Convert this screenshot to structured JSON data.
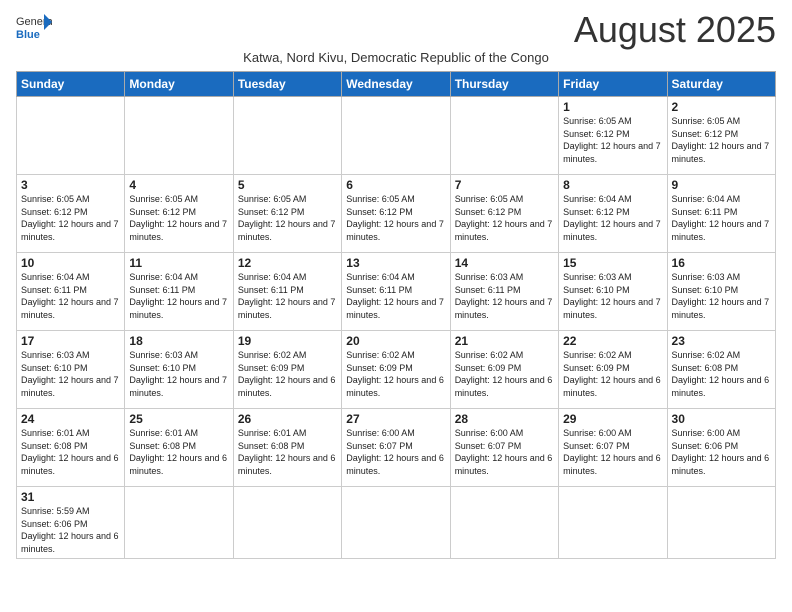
{
  "header": {
    "logo_general": "General",
    "logo_blue": "Blue",
    "month_title": "August 2025",
    "subtitle": "Katwa, Nord Kivu, Democratic Republic of the Congo"
  },
  "weekdays": [
    "Sunday",
    "Monday",
    "Tuesday",
    "Wednesday",
    "Thursday",
    "Friday",
    "Saturday"
  ],
  "weeks": [
    [
      {
        "day": "",
        "info": ""
      },
      {
        "day": "",
        "info": ""
      },
      {
        "day": "",
        "info": ""
      },
      {
        "day": "",
        "info": ""
      },
      {
        "day": "",
        "info": ""
      },
      {
        "day": "1",
        "info": "Sunrise: 6:05 AM\nSunset: 6:12 PM\nDaylight: 12 hours and 7 minutes."
      },
      {
        "day": "2",
        "info": "Sunrise: 6:05 AM\nSunset: 6:12 PM\nDaylight: 12 hours and 7 minutes."
      }
    ],
    [
      {
        "day": "3",
        "info": "Sunrise: 6:05 AM\nSunset: 6:12 PM\nDaylight: 12 hours and 7 minutes."
      },
      {
        "day": "4",
        "info": "Sunrise: 6:05 AM\nSunset: 6:12 PM\nDaylight: 12 hours and 7 minutes."
      },
      {
        "day": "5",
        "info": "Sunrise: 6:05 AM\nSunset: 6:12 PM\nDaylight: 12 hours and 7 minutes."
      },
      {
        "day": "6",
        "info": "Sunrise: 6:05 AM\nSunset: 6:12 PM\nDaylight: 12 hours and 7 minutes."
      },
      {
        "day": "7",
        "info": "Sunrise: 6:05 AM\nSunset: 6:12 PM\nDaylight: 12 hours and 7 minutes."
      },
      {
        "day": "8",
        "info": "Sunrise: 6:04 AM\nSunset: 6:12 PM\nDaylight: 12 hours and 7 minutes."
      },
      {
        "day": "9",
        "info": "Sunrise: 6:04 AM\nSunset: 6:11 PM\nDaylight: 12 hours and 7 minutes."
      }
    ],
    [
      {
        "day": "10",
        "info": "Sunrise: 6:04 AM\nSunset: 6:11 PM\nDaylight: 12 hours and 7 minutes."
      },
      {
        "day": "11",
        "info": "Sunrise: 6:04 AM\nSunset: 6:11 PM\nDaylight: 12 hours and 7 minutes."
      },
      {
        "day": "12",
        "info": "Sunrise: 6:04 AM\nSunset: 6:11 PM\nDaylight: 12 hours and 7 minutes."
      },
      {
        "day": "13",
        "info": "Sunrise: 6:04 AM\nSunset: 6:11 PM\nDaylight: 12 hours and 7 minutes."
      },
      {
        "day": "14",
        "info": "Sunrise: 6:03 AM\nSunset: 6:11 PM\nDaylight: 12 hours and 7 minutes."
      },
      {
        "day": "15",
        "info": "Sunrise: 6:03 AM\nSunset: 6:10 PM\nDaylight: 12 hours and 7 minutes."
      },
      {
        "day": "16",
        "info": "Sunrise: 6:03 AM\nSunset: 6:10 PM\nDaylight: 12 hours and 7 minutes."
      }
    ],
    [
      {
        "day": "17",
        "info": "Sunrise: 6:03 AM\nSunset: 6:10 PM\nDaylight: 12 hours and 7 minutes."
      },
      {
        "day": "18",
        "info": "Sunrise: 6:03 AM\nSunset: 6:10 PM\nDaylight: 12 hours and 7 minutes."
      },
      {
        "day": "19",
        "info": "Sunrise: 6:02 AM\nSunset: 6:09 PM\nDaylight: 12 hours and 6 minutes."
      },
      {
        "day": "20",
        "info": "Sunrise: 6:02 AM\nSunset: 6:09 PM\nDaylight: 12 hours and 6 minutes."
      },
      {
        "day": "21",
        "info": "Sunrise: 6:02 AM\nSunset: 6:09 PM\nDaylight: 12 hours and 6 minutes."
      },
      {
        "day": "22",
        "info": "Sunrise: 6:02 AM\nSunset: 6:09 PM\nDaylight: 12 hours and 6 minutes."
      },
      {
        "day": "23",
        "info": "Sunrise: 6:02 AM\nSunset: 6:08 PM\nDaylight: 12 hours and 6 minutes."
      }
    ],
    [
      {
        "day": "24",
        "info": "Sunrise: 6:01 AM\nSunset: 6:08 PM\nDaylight: 12 hours and 6 minutes."
      },
      {
        "day": "25",
        "info": "Sunrise: 6:01 AM\nSunset: 6:08 PM\nDaylight: 12 hours and 6 minutes."
      },
      {
        "day": "26",
        "info": "Sunrise: 6:01 AM\nSunset: 6:08 PM\nDaylight: 12 hours and 6 minutes."
      },
      {
        "day": "27",
        "info": "Sunrise: 6:00 AM\nSunset: 6:07 PM\nDaylight: 12 hours and 6 minutes."
      },
      {
        "day": "28",
        "info": "Sunrise: 6:00 AM\nSunset: 6:07 PM\nDaylight: 12 hours and 6 minutes."
      },
      {
        "day": "29",
        "info": "Sunrise: 6:00 AM\nSunset: 6:07 PM\nDaylight: 12 hours and 6 minutes."
      },
      {
        "day": "30",
        "info": "Sunrise: 6:00 AM\nSunset: 6:06 PM\nDaylight: 12 hours and 6 minutes."
      }
    ],
    [
      {
        "day": "31",
        "info": "Sunrise: 5:59 AM\nSunset: 6:06 PM\nDaylight: 12 hours and 6 minutes."
      },
      {
        "day": "",
        "info": ""
      },
      {
        "day": "",
        "info": ""
      },
      {
        "day": "",
        "info": ""
      },
      {
        "day": "",
        "info": ""
      },
      {
        "day": "",
        "info": ""
      },
      {
        "day": "",
        "info": ""
      }
    ]
  ]
}
